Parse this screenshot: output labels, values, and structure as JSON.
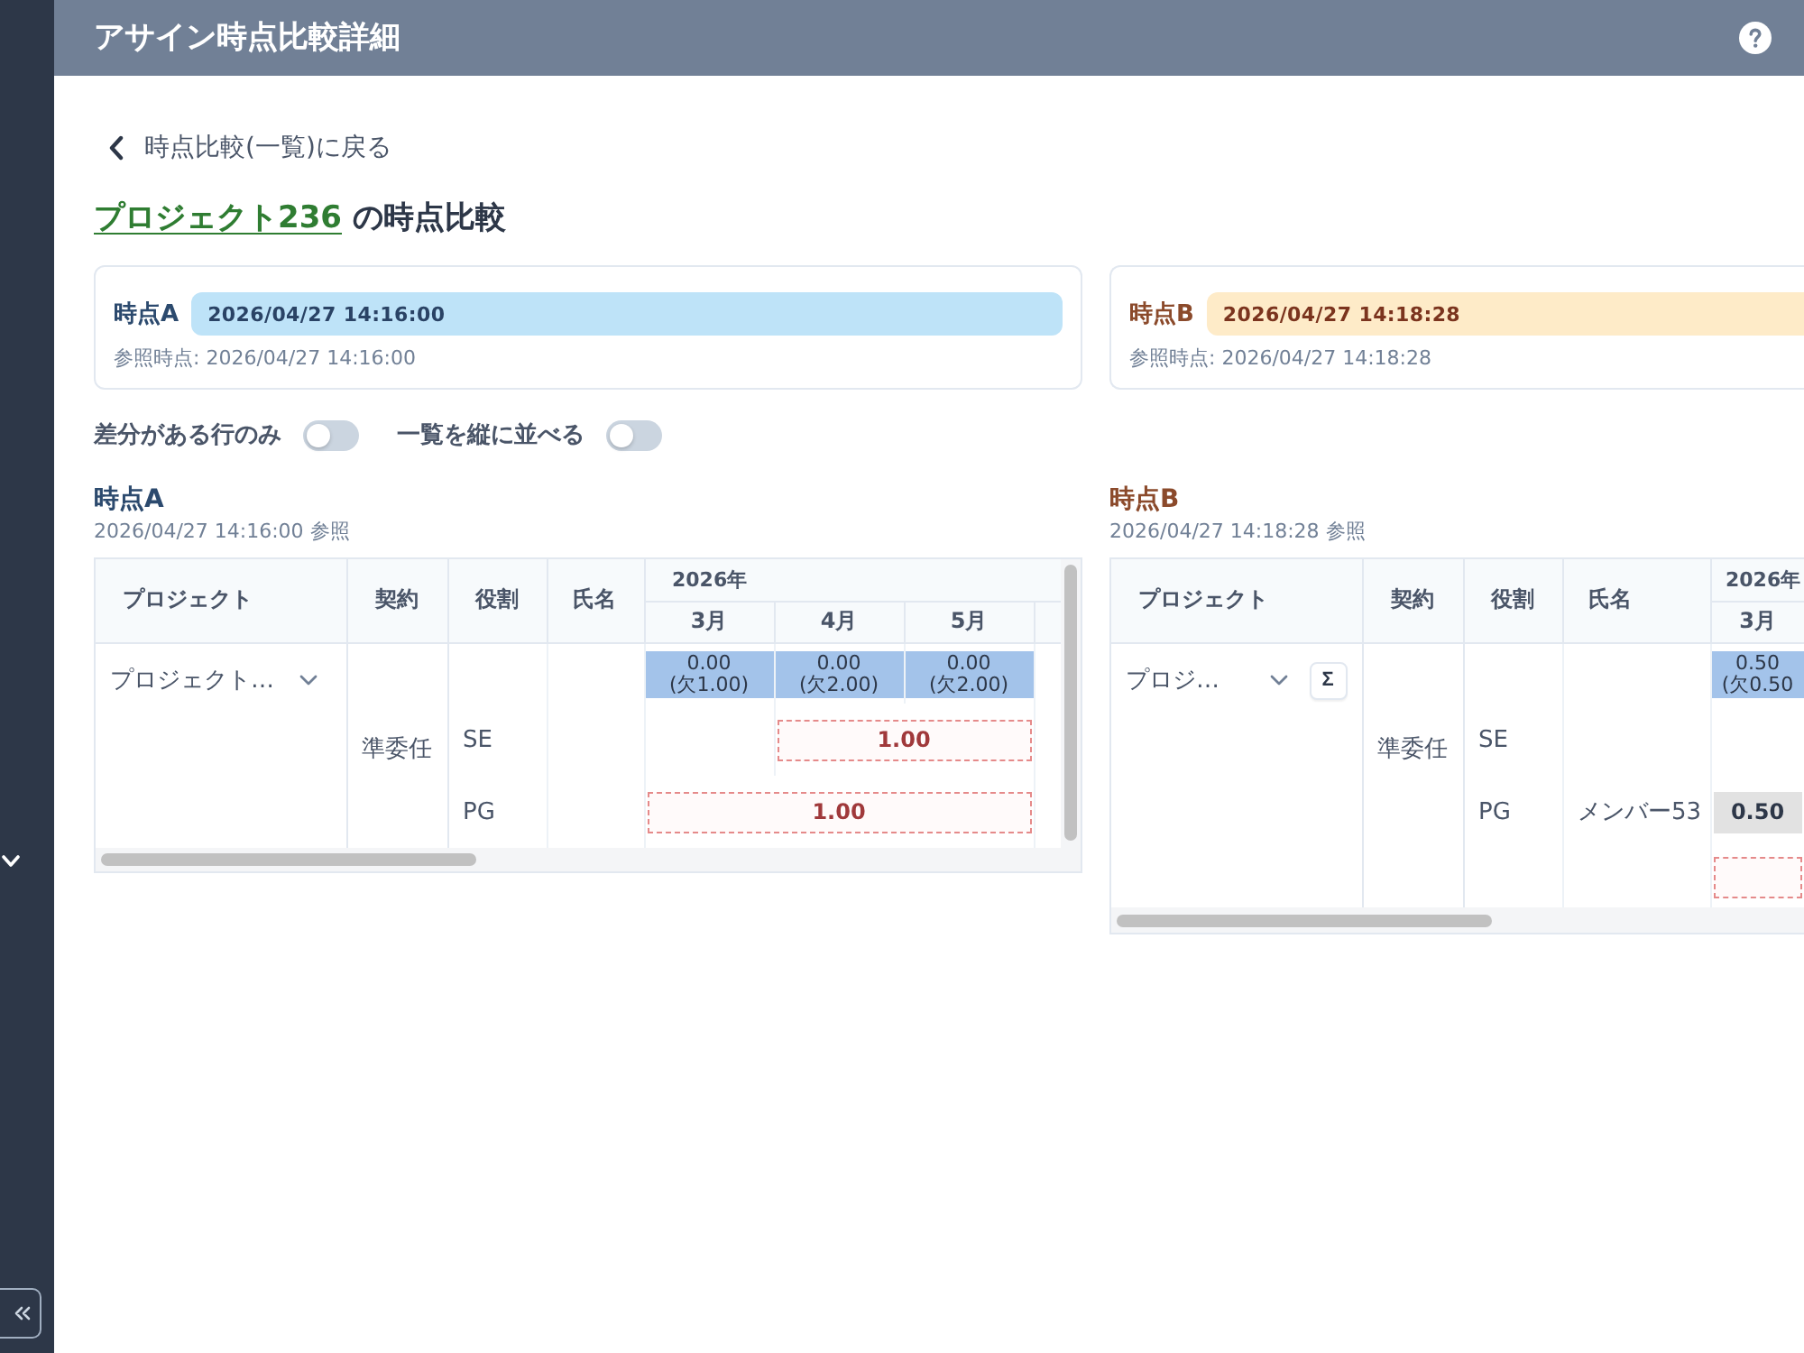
{
  "header": {
    "title": "アサイン時点比較詳細"
  },
  "back_link": "時点比較(一覧)に戻る",
  "page_title": {
    "project_link": "プロジェクト236",
    "suffix": "の時点比較"
  },
  "snapshots": [
    {
      "kind": "earlier",
      "label": "時点A",
      "timestamp": "2026/04/27 14:16:00",
      "reference": "参照時点: 2026/04/27 14:16:00"
    },
    {
      "kind": "later",
      "label": "時点B",
      "timestamp": "2026/04/27 14:18:28",
      "reference": "参照時点: 2026/04/27 14:18:28"
    }
  ],
  "toggles": [
    {
      "label": "差分がある行のみ",
      "on": false
    },
    {
      "label": "一覧を縦に並べる",
      "on": false
    }
  ],
  "panels": [
    {
      "kind": "earlier",
      "heading": "時点A",
      "caption": "2026/04/27 14:16:00 参照",
      "table": {
        "columns": [
          "プロジェクト",
          "契約",
          "役割",
          "氏名"
        ],
        "year": "2026年",
        "months": [
          "3月",
          "4月",
          "5月"
        ],
        "project": "プロジェクト…",
        "contract": "準委任",
        "rows": [
          {
            "cells": [
              {
                "kind": "shortage",
                "value": "0.00",
                "note": "(欠1.00)"
              },
              {
                "kind": "shortage",
                "value": "0.00",
                "note": "(欠2.00)"
              },
              {
                "kind": "shortage",
                "value": "0.00",
                "note": "(欠2.00)"
              }
            ]
          },
          {
            "role": "SE",
            "cells": [
              {
                "kind": "empty"
              },
              {
                "kind": "planned",
                "value": "1.00",
                "colspan": 2
              }
            ]
          },
          {
            "role": "PG",
            "cells": [
              {
                "kind": "planned",
                "value": "1.00",
                "colspan": 3
              }
            ]
          }
        ]
      }
    },
    {
      "kind": "later",
      "heading": "時点B",
      "caption": "2026/04/27 14:18:28 参照",
      "table": {
        "columns": [
          "プロジェクト",
          "契約",
          "役割",
          "氏名"
        ],
        "year": "2026年",
        "months": [
          "3月"
        ],
        "project": "プロジ…",
        "sum_button": "Σ",
        "contract": "準委任",
        "rows": [
          {
            "cells": [
              {
                "kind": "shortage",
                "value": "0.50",
                "note": "(欠0.50"
              }
            ]
          },
          {
            "role": "SE",
            "cells": [
              {
                "kind": "empty"
              }
            ]
          },
          {
            "role": "PG",
            "member": "メンバー53",
            "cells": [
              {
                "kind": "assigned",
                "value": "0.50"
              }
            ]
          },
          {
            "cells": [
              {
                "kind": "planned"
              }
            ]
          }
        ]
      }
    }
  ]
}
